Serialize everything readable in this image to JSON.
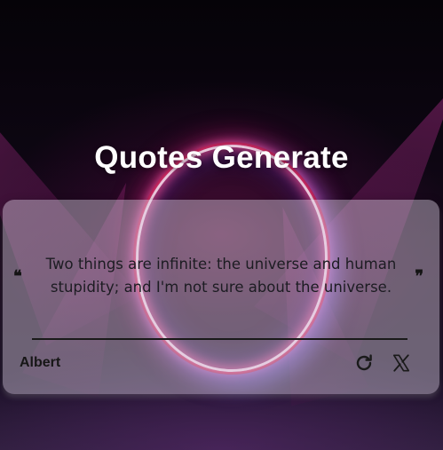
{
  "page": {
    "title": "Quotes Generate"
  },
  "quote": {
    "open_mark": "❝",
    "text": "Two things are infinite: the universe and human stupidity; and I'm not sure about the universe.",
    "close_mark": "❞",
    "author": "Albert"
  },
  "actions": {
    "new_quote_icon": "refresh-icon",
    "share_icon": "x-logo-icon"
  },
  "colors": {
    "card_bg": "#e1d7e8",
    "title": "#ffffff",
    "text": "#1c1c22",
    "ring_glow": "#ff3c78"
  }
}
